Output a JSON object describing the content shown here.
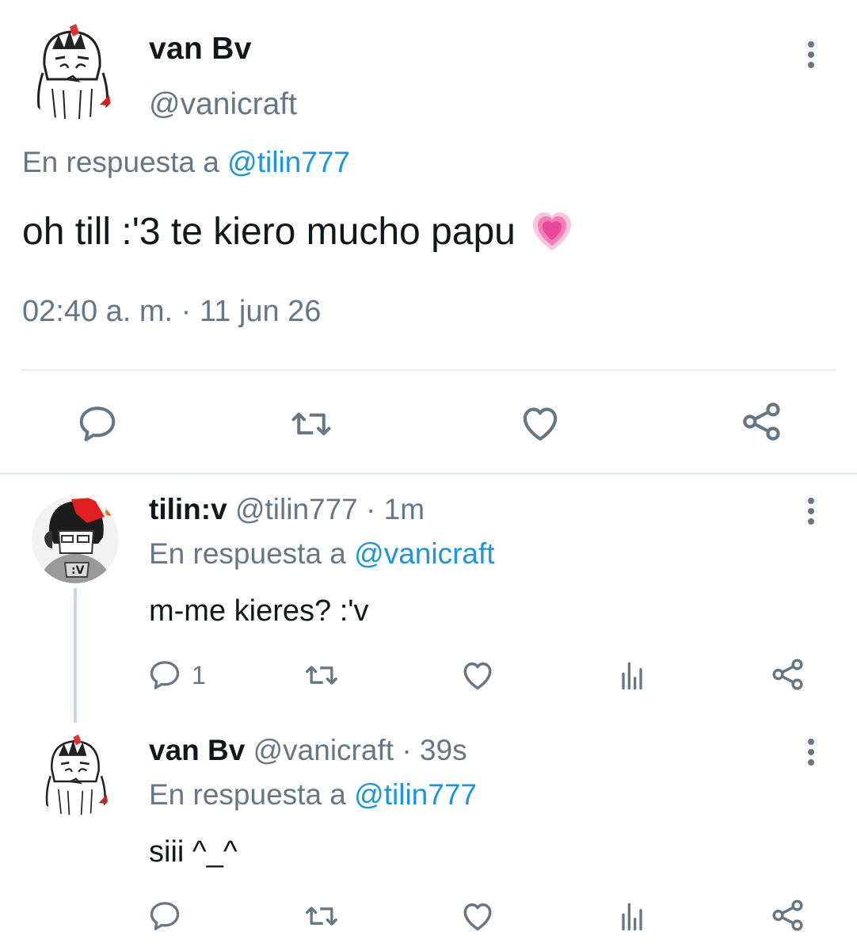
{
  "main_tweet": {
    "name": "van Bv",
    "handle": "@vanicraft",
    "reply_prefix": "En respuesta a",
    "reply_to": "@tilin777",
    "text": "oh till :'3 te kiero mucho papu",
    "emoji": "growing-heart-emoji",
    "timestamp": "02:40 a. m. · 11 jun 26",
    "actions": [
      "reply-icon",
      "retweet-icon",
      "like-icon",
      "share-icon"
    ]
  },
  "replies": [
    {
      "name": "tilin:v",
      "handle": "@tilin777",
      "time": "· 1m",
      "reply_prefix": "En respuesta a",
      "reply_to": "@vanicraft",
      "text": "m-me kieres? :'v",
      "reply_count": "1",
      "actions": [
        "reply-icon",
        "retweet-icon",
        "like-icon",
        "analytics-icon",
        "share-icon"
      ]
    },
    {
      "name": "van Bv",
      "handle": "@vanicraft",
      "time": "· 39s",
      "reply_prefix": "En respuesta a",
      "reply_to": "@tilin777",
      "text": "siii ^_^",
      "reply_count": "",
      "actions": [
        "reply-icon",
        "retweet-icon",
        "like-icon",
        "analytics-icon",
        "share-icon"
      ]
    }
  ],
  "colors": {
    "text": "#14171a",
    "secondary": "#657786",
    "link": "#1b95e0",
    "divider": "#e6ecf0",
    "heart": "#f06fae"
  }
}
